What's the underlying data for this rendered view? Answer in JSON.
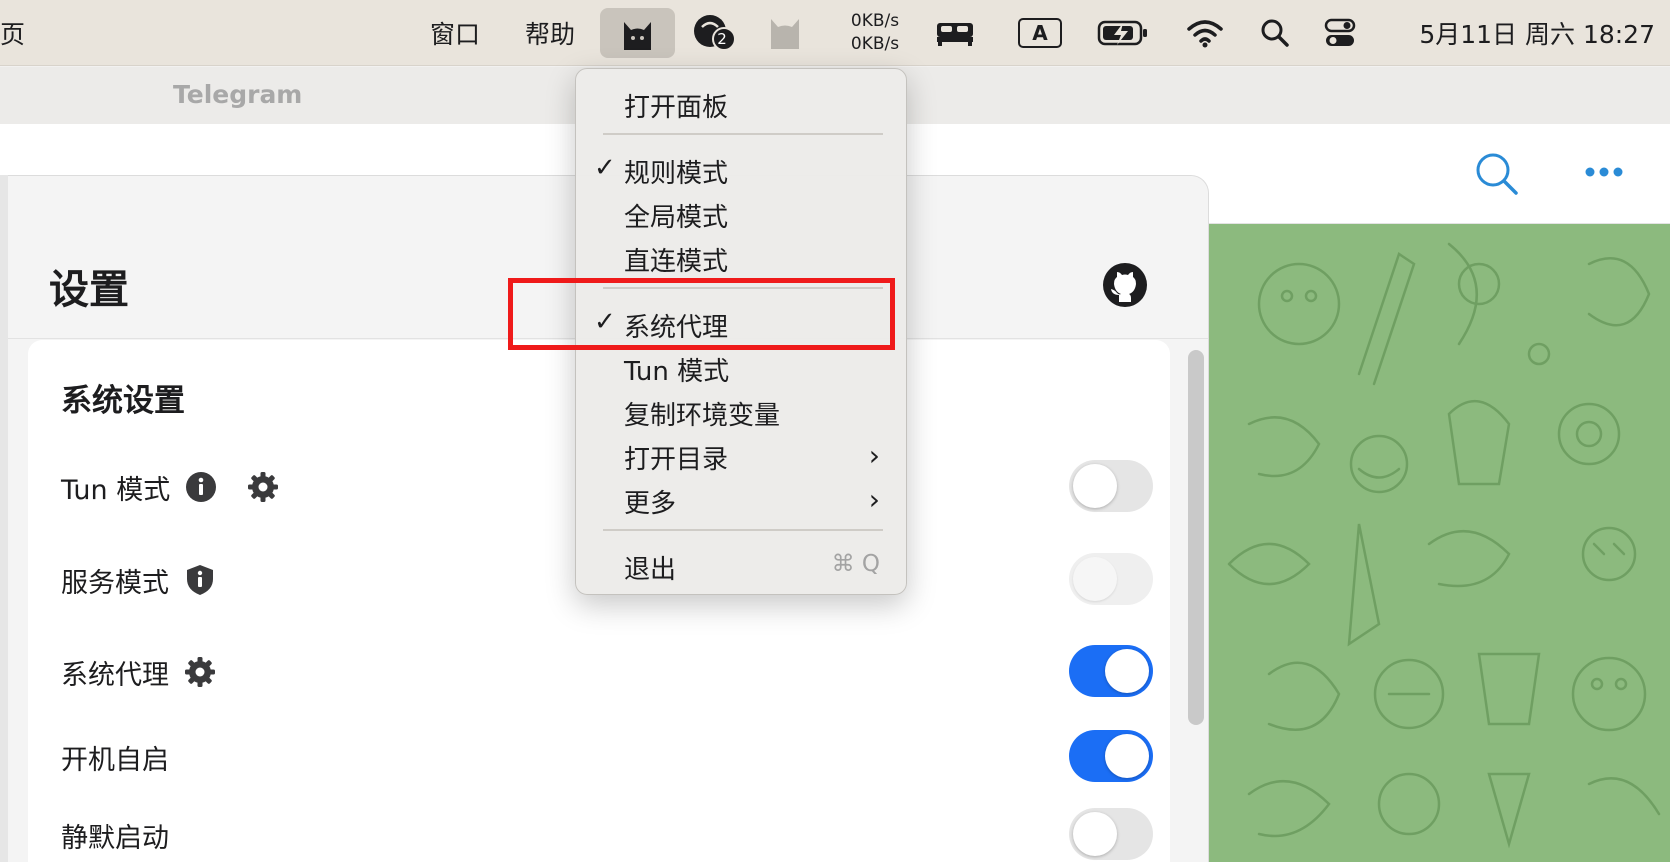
{
  "menubar": {
    "left_fragment": "页",
    "menu_window": "窗口",
    "menu_help": "帮助",
    "chat_badge": "2",
    "net_up": "0KB/s",
    "net_down": "0KB/s",
    "input_badge": "A",
    "datetime": "5月11日 周六  18:27"
  },
  "telegram": {
    "title": "Telegram"
  },
  "clash": {
    "page_title": "设置",
    "section_title": "系统设置",
    "rows": [
      {
        "label": "Tun 模式",
        "state": "off"
      },
      {
        "label": "服务模式",
        "state": "disabled"
      },
      {
        "label": "系统代理",
        "state": "on"
      },
      {
        "label": "开机自启",
        "state": "on"
      },
      {
        "label": "静默启动",
        "state": "off"
      }
    ]
  },
  "tray_menu": {
    "open_panel": "打开面板",
    "rule_mode": "规则模式",
    "global_mode": "全局模式",
    "direct_mode": "直连模式",
    "system_proxy": "系统代理",
    "tun_mode": "Tun 模式",
    "copy_env": "复制环境变量",
    "open_dir": "打开目录",
    "more": "更多",
    "quit": "退出",
    "quit_shortcut": "⌘ Q",
    "check_mark": "✓",
    "chevron": "›"
  },
  "colors": {
    "toggle_on": "#1b6ef5",
    "highlight": "#ef1a1a",
    "chat_bg": "#8cba7e",
    "accent": "#2a8bd6"
  }
}
